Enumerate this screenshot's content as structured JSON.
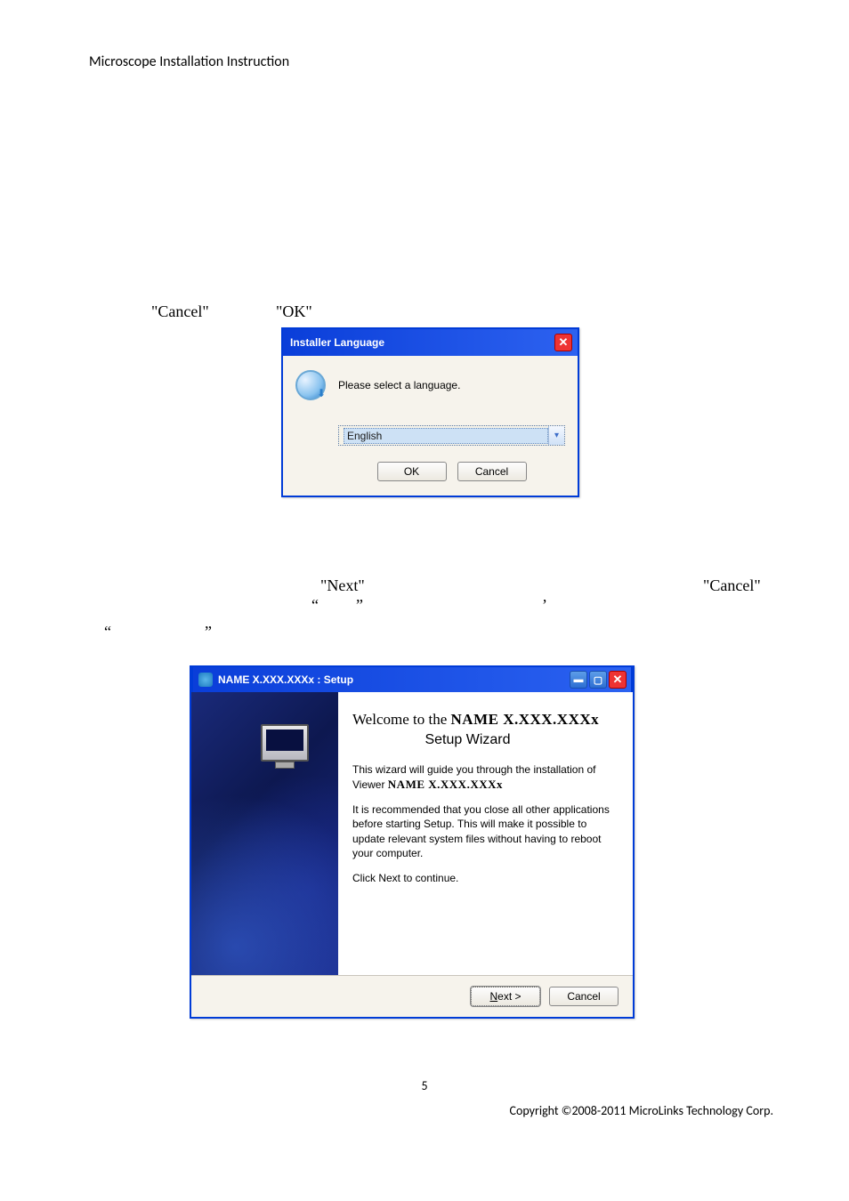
{
  "header": "Microscope Installation Instruction",
  "captions": {
    "cancel": "\"Cancel\"",
    "ok": "\"OK\"",
    "next": "\"Next\"",
    "cancel2": "\"Cancel\"",
    "quote_open": "“",
    "quote_close": "”",
    "comma": "’"
  },
  "dlg1": {
    "title": "Installer Language",
    "prompt": "Please select a language.",
    "selected": "English",
    "ok": "OK",
    "cancel": "Cancel"
  },
  "dlg2": {
    "title": "NAME X.XXX.XXXx : Setup",
    "welcome_prefix": "Welcome to the ",
    "welcome_name": "NAME X.XXX.XXXx",
    "welcome_line2": "Setup Wizard",
    "p1a": "This wizard will guide you through the installation of",
    "p1b_prefix": "Viewer ",
    "p1b_name": "NAME X.XXX.XXXx",
    "p2": "It is recommended that you close all other applications before starting Setup. This will make it possible to update relevant system files without having to reboot your computer.",
    "p3": "Click Next to continue.",
    "next_u": "N",
    "next_rest": "ext >",
    "cancel": "Cancel"
  },
  "page_no": "5",
  "copyright": "Copyright ©2008-2011 MicroLinks Technology Corp."
}
